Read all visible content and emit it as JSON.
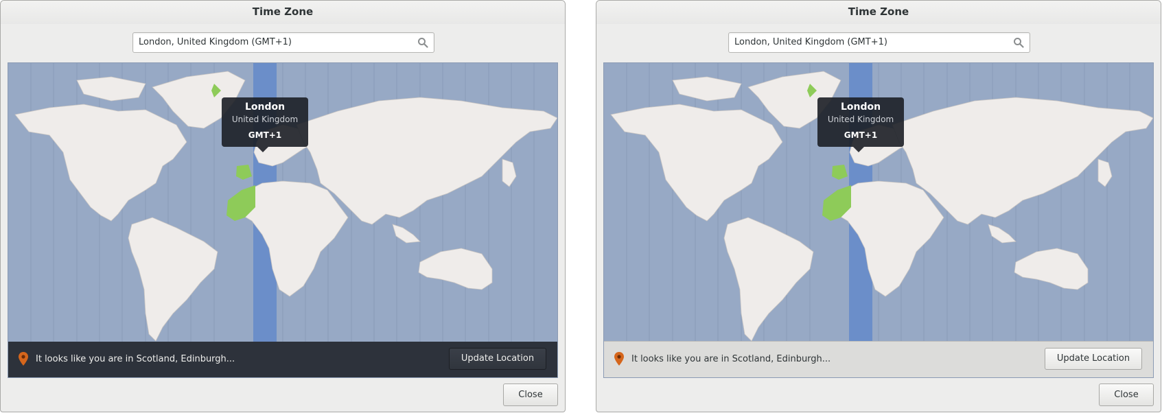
{
  "dialogs": [
    {
      "title": "Time Zone",
      "search_value": "London, United Kingdom (GMT+1)",
      "tooltip": {
        "city": "London",
        "country": "United Kingdom",
        "offset": "GMT+1"
      },
      "infobar_text": "It looks like you are in Scotland, Edinburgh...",
      "update_label": "Update Location",
      "close_label": "Close",
      "infobar_style": "dark"
    },
    {
      "title": "Time Zone",
      "search_value": "London, United Kingdom (GMT+1)",
      "tooltip": {
        "city": "London",
        "country": "United Kingdom",
        "offset": "GMT+1"
      },
      "infobar_text": "It looks like you are in Scotland, Edinburgh...",
      "update_label": "Update Location",
      "close_label": "Close",
      "infobar_style": "light"
    }
  ],
  "colors": {
    "ocean": "#97a9c5",
    "land": "#efecea",
    "selected_zone_band": "#6b8ec9",
    "selected_zone_land": "#8ecb59",
    "pin": "#d5661c"
  },
  "icons": {
    "search": "search-icon",
    "location": "map-pin-icon"
  }
}
